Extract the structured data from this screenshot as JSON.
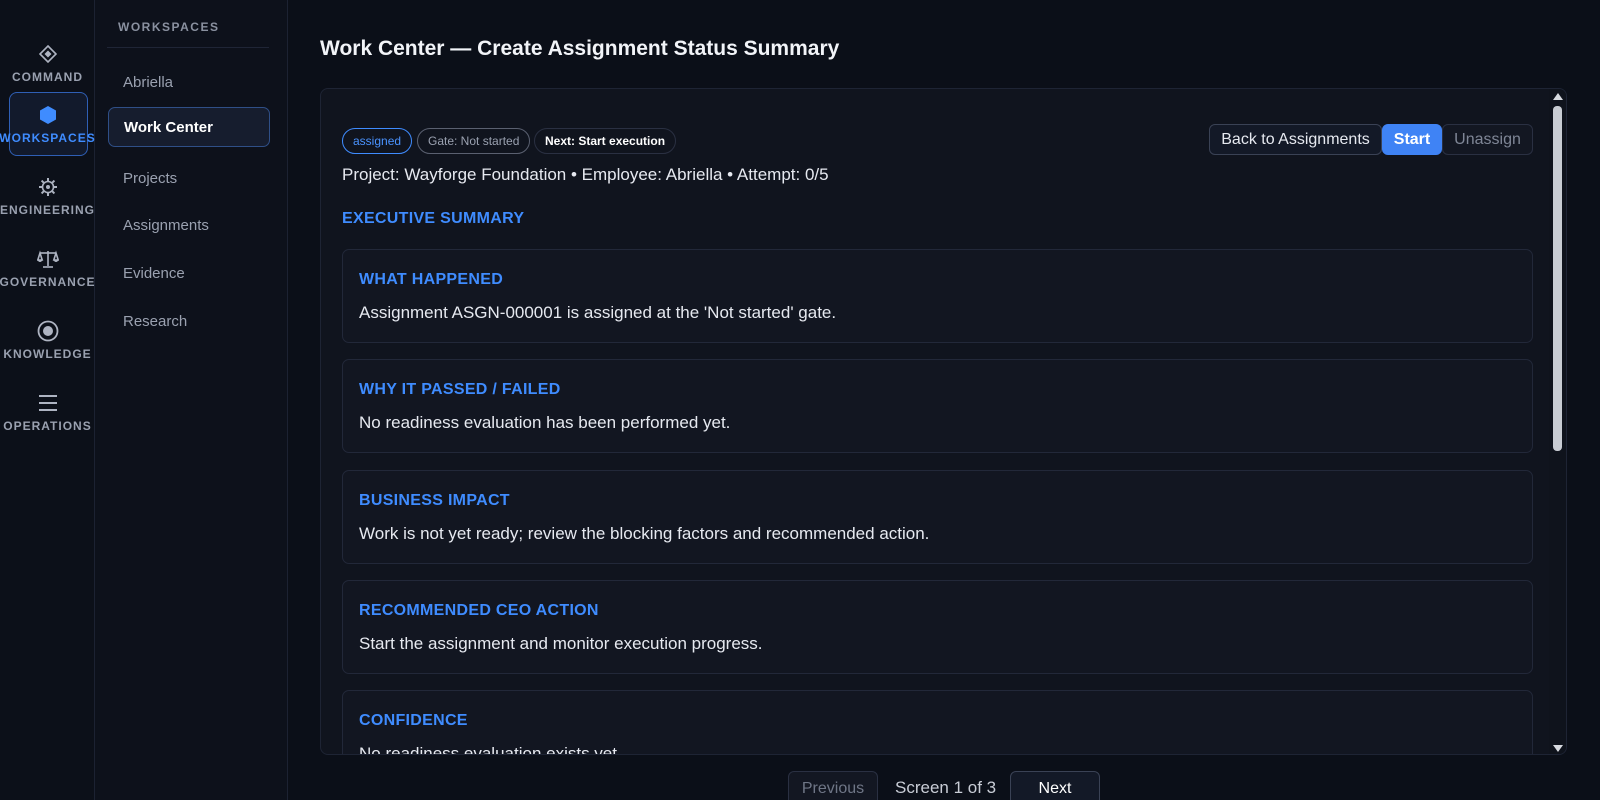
{
  "rail": {
    "items": [
      {
        "key": "command",
        "label": "COMMAND",
        "icon": "diamond-icon"
      },
      {
        "key": "workspaces",
        "label": "WORKSPACES",
        "icon": "hexagon-icon",
        "active": true
      },
      {
        "key": "engineering",
        "label": "ENGINEERING",
        "icon": "gear-icon"
      },
      {
        "key": "governance",
        "label": "GOVERNANCE",
        "icon": "scales-icon"
      },
      {
        "key": "knowledge",
        "label": "KNOWLEDGE",
        "icon": "target-icon"
      },
      {
        "key": "operations",
        "label": "OPERATIONS",
        "icon": "menu-icon"
      }
    ]
  },
  "subnav": {
    "title": "WORKSPACES",
    "items": [
      {
        "label": "Abriella"
      },
      {
        "label": "Work Center",
        "active": true
      },
      {
        "label": "Projects"
      },
      {
        "label": "Assignments"
      },
      {
        "label": "Evidence"
      },
      {
        "label": "Research"
      }
    ]
  },
  "page": {
    "title": "Work Center — Create Assignment Status Summary"
  },
  "status": {
    "state_chip": "assigned",
    "gate_chip": "Gate: Not started",
    "next_chip": "Next: Start execution"
  },
  "actions": {
    "back_label": "Back to Assignments",
    "start_label": "Start",
    "unassign_label": "Unassign"
  },
  "meta_line": "Project: Wayforge Foundation • Employee: Abriella • Attempt: 0/5",
  "summary": {
    "heading": "EXECUTIVE SUMMARY",
    "cards": [
      {
        "title": "WHAT HAPPENED",
        "text": "Assignment ASGN-000001 is assigned at the 'Not started' gate."
      },
      {
        "title": "WHY IT PASSED / FAILED",
        "text": "No readiness evaluation has been performed yet."
      },
      {
        "title": "BUSINESS IMPACT",
        "text": "Work is not yet ready; review the blocking factors and recommended action."
      },
      {
        "title": "RECOMMENDED CEO ACTION",
        "text": "Start the assignment and monitor execution progress."
      },
      {
        "title": "CONFIDENCE",
        "text": "No readiness evaluation exists yet."
      }
    ]
  },
  "pager": {
    "prev_label": "Previous",
    "screen_label": "Screen 1 of 3",
    "next_label": "Next"
  },
  "colors": {
    "accent": "#3f8cff",
    "background": "#0b0f18",
    "primary_button": "#3f83f5"
  }
}
